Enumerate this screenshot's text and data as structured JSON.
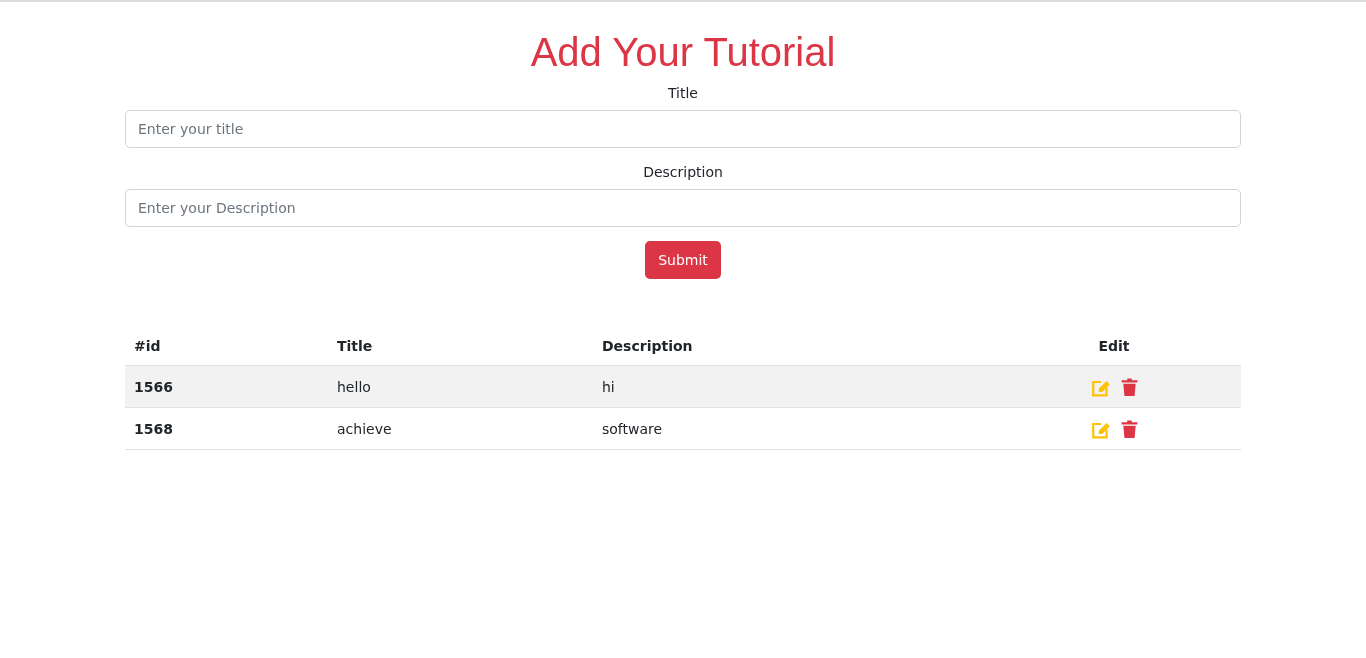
{
  "heading": "Add Your Tutorial",
  "fields": [
    {
      "label": "Title",
      "placeholder": "Enter your title"
    },
    {
      "label": "Description",
      "placeholder": "Enter your Description"
    }
  ],
  "submit_button": "Submit",
  "table": {
    "columns": [
      "#id",
      "Title",
      "Description",
      "Edit"
    ],
    "rows": [
      {
        "id": "1566",
        "title": "hello",
        "description": "hi"
      },
      {
        "id": "1568",
        "title": "achieve",
        "description": "software"
      }
    ]
  }
}
